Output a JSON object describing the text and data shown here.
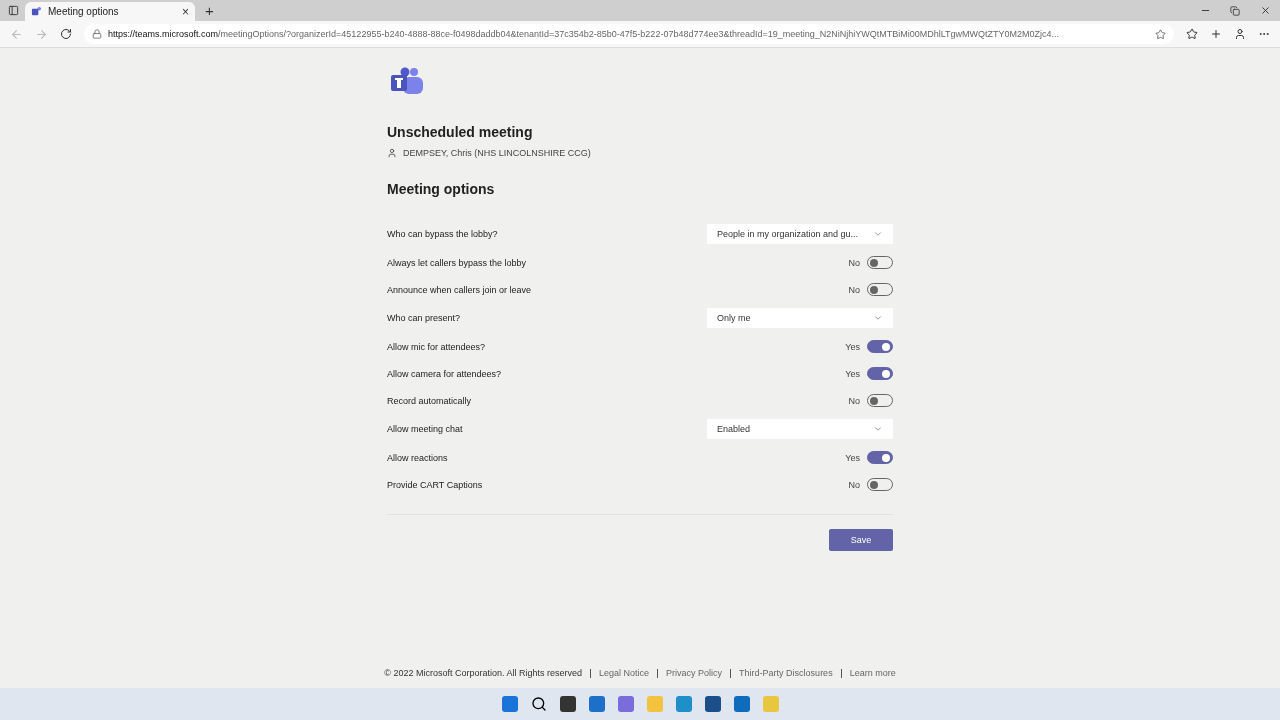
{
  "browser": {
    "tab_title": "Meeting options",
    "tab_close": "×",
    "new_tab": "+",
    "url_host": "https://teams.microsoft.com",
    "url_path": "/meetingOptions/?organizerId=45122955-b240-4888-88ce-f0498daddb04&tenantId=37c354b2-85b0-47f5-b222-07b48d774ee3&threadId=19_meeting_N2NiNjhiYWQtMTBiMi00MDhlLTgwMWQtZTY0M2M0Zjc4..."
  },
  "meeting": {
    "title": "Unscheduled meeting",
    "organizer": "DEMPSEY, Chris (NHS LINCOLNSHIRE CCG)"
  },
  "section_title": "Meeting options",
  "options": [
    {
      "kind": "dropdown",
      "label": "Who can bypass the lobby?",
      "value": "People in my organization and gu..."
    },
    {
      "kind": "toggle",
      "label": "Always let callers bypass the lobby",
      "value": "No",
      "on": false
    },
    {
      "kind": "toggle",
      "label": "Announce when callers join or leave",
      "value": "No",
      "on": false
    },
    {
      "kind": "dropdown",
      "label": "Who can present?",
      "value": "Only me"
    },
    {
      "kind": "toggle",
      "label": "Allow mic for attendees?",
      "value": "Yes",
      "on": true
    },
    {
      "kind": "toggle",
      "label": "Allow camera for attendees?",
      "value": "Yes",
      "on": true
    },
    {
      "kind": "toggle",
      "label": "Record automatically",
      "value": "No",
      "on": false
    },
    {
      "kind": "dropdown",
      "label": "Allow meeting chat",
      "value": "Enabled"
    },
    {
      "kind": "toggle",
      "label": "Allow reactions",
      "value": "Yes",
      "on": true
    },
    {
      "kind": "toggle",
      "label": "Provide CART Captions",
      "value": "No",
      "on": false
    }
  ],
  "save_button": "Save",
  "footer": {
    "copyright": "© 2022 Microsoft Corporation. All Rights reserved",
    "links": [
      "Legal Notice",
      "Privacy Policy",
      "Third-Party Disclosures",
      "Learn more"
    ]
  }
}
